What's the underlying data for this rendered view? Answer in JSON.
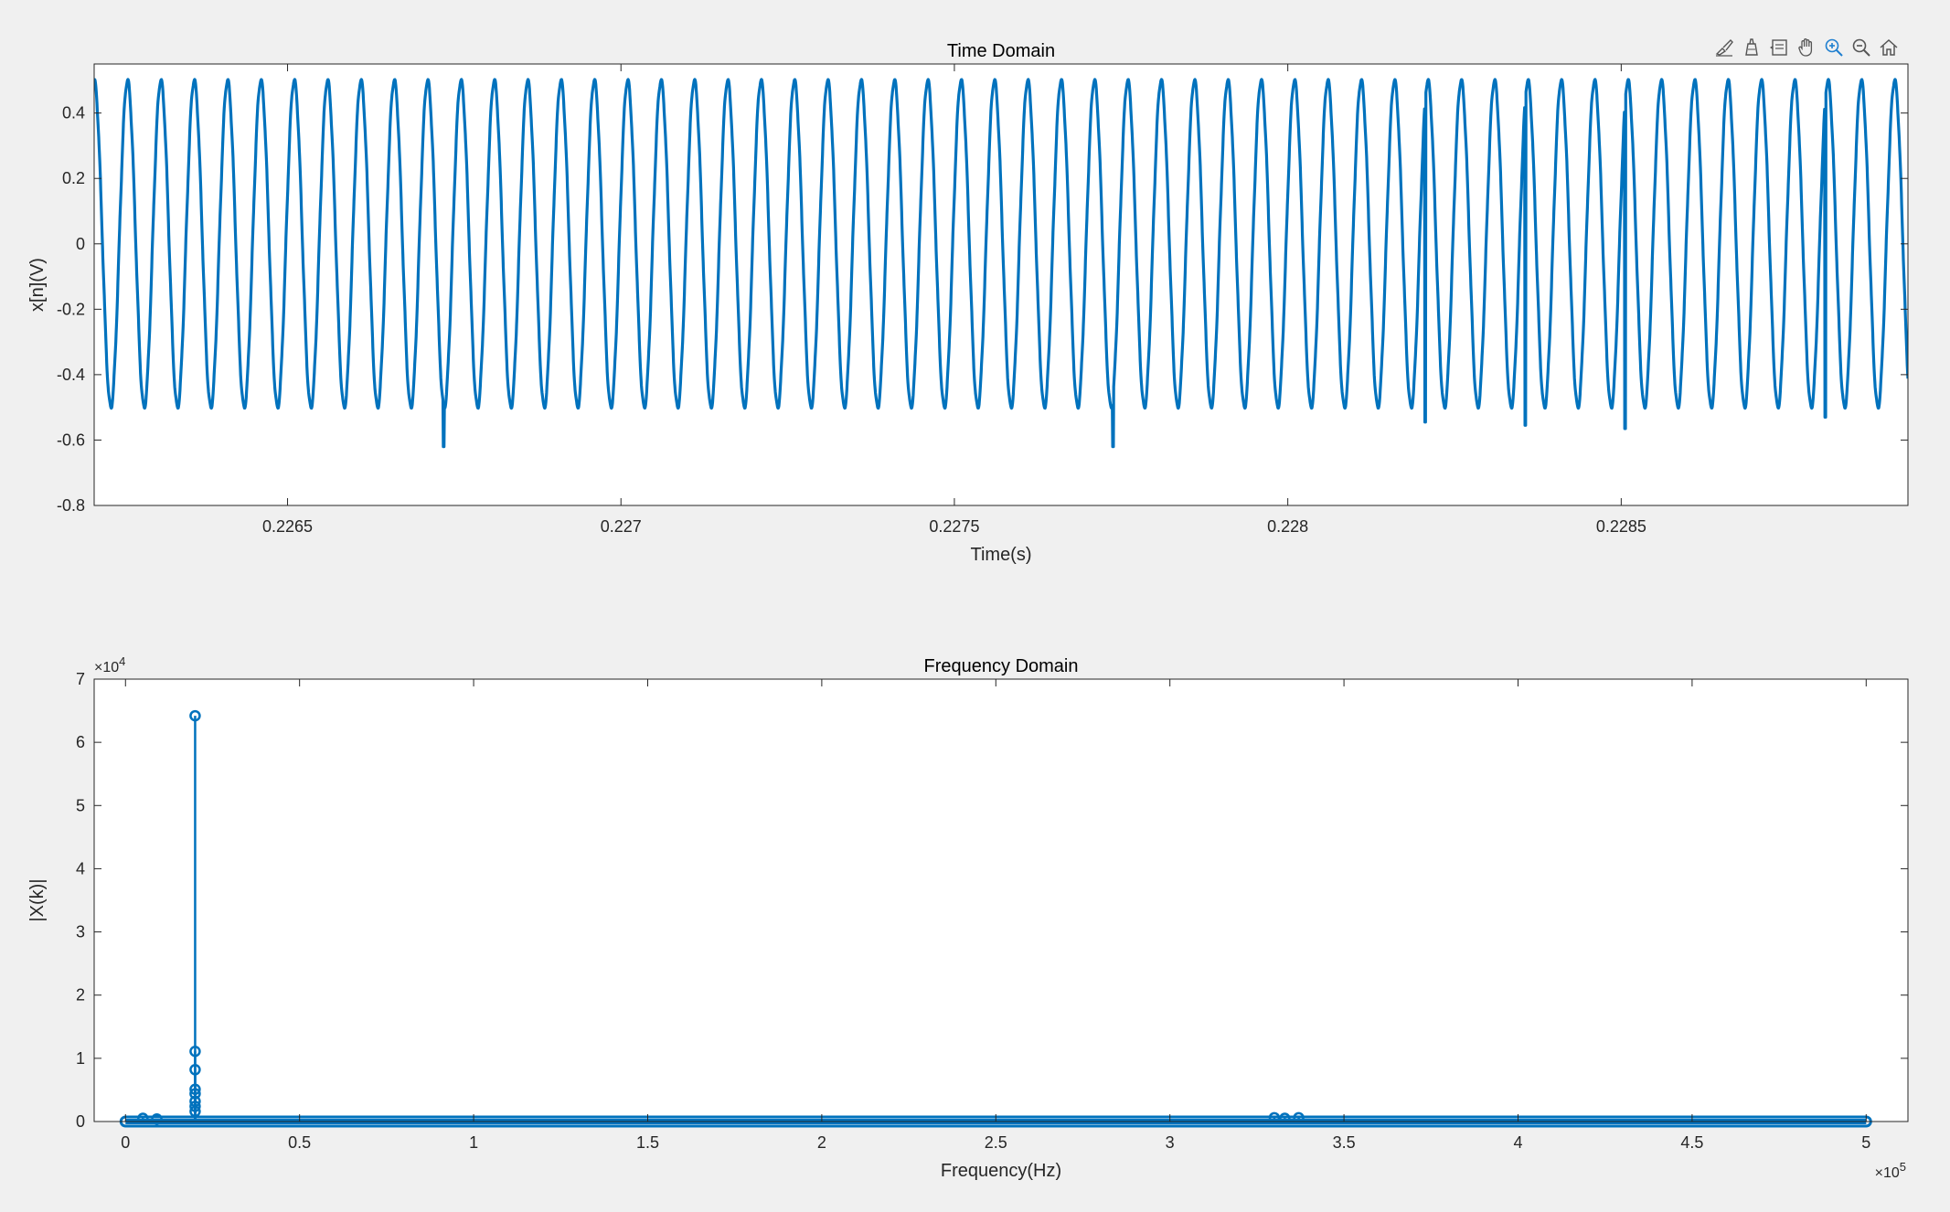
{
  "toolbar": {
    "icons": [
      "brush-icon",
      "data-cursor-icon",
      "datatip-icon",
      "pan-icon",
      "zoom-in-icon",
      "zoom-out-icon",
      "home-icon"
    ]
  },
  "colors": {
    "line": "#0072BD",
    "background": "#f0f0f0",
    "axes": "#ffffff",
    "axis_line": "#262626"
  },
  "chart_data": [
    {
      "type": "line",
      "title": "Time Domain",
      "xlabel": "Time(s)",
      "ylabel": "x[n](V)",
      "xlim": [
        0.22621,
        0.22893
      ],
      "ylim": [
        -0.8,
        0.55
      ],
      "xticks": [
        0.2265,
        0.227,
        0.2275,
        0.228,
        0.2285
      ],
      "xtick_labels": [
        "0.2265",
        "0.227",
        "0.2275",
        "0.228",
        "0.2285"
      ],
      "yticks": [
        -0.8,
        -0.6,
        -0.4,
        -0.2,
        0,
        0.2,
        0.4
      ],
      "ytick_labels": [
        "-0.8",
        "-0.6",
        "-0.4",
        "-0.2",
        "0",
        "0.2",
        "0.4"
      ],
      "signal": {
        "frequency_hz": 20000,
        "amplitude_v": 0.5,
        "t_start": 0.22621,
        "t_end": 0.22893,
        "start_value": 0.5,
        "end_value": -0.5,
        "spikes": [
          {
            "t": 0.226734,
            "v": -0.62
          },
          {
            "t": 0.227738,
            "v": -0.62
          },
          {
            "t": 0.228206,
            "v": -0.545
          },
          {
            "t": 0.228356,
            "v": -0.555
          },
          {
            "t": 0.228506,
            "v": -0.565
          },
          {
            "t": 0.228806,
            "v": -0.53
          }
        ]
      },
      "grid": false
    },
    {
      "type": "stem",
      "title": "Frequency Domain",
      "xlabel": "Frequency(Hz)",
      "ylabel": "|X(k)|",
      "x_multiplier_label": "×10",
      "x_multiplier_exp": "5",
      "y_multiplier_label": "×10",
      "y_multiplier_exp": "4",
      "xlim": [
        -9000,
        512000
      ],
      "ylim": [
        0,
        70000
      ],
      "xticks": [
        0,
        50000,
        100000,
        150000,
        200000,
        250000,
        300000,
        350000,
        400000,
        450000,
        500000
      ],
      "xtick_labels": [
        "0",
        "0.5",
        "1",
        "1.5",
        "2",
        "2.5",
        "3",
        "3.5",
        "4",
        "4.5",
        "5"
      ],
      "yticks": [
        0,
        10000,
        20000,
        30000,
        40000,
        50000,
        60000,
        70000
      ],
      "ytick_labels": [
        "0",
        "1",
        "2",
        "3",
        "4",
        "5",
        "6",
        "7"
      ],
      "x_range": [
        0,
        500000
      ],
      "baseline_value": 0,
      "peaks": [
        {
          "x": 20000,
          "y": 64200
        },
        {
          "x": 20000,
          "y": 11100
        },
        {
          "x": 20000,
          "y": 8200
        },
        {
          "x": 20000,
          "y": 5100
        },
        {
          "x": 20000,
          "y": 4400
        },
        {
          "x": 20000,
          "y": 3200
        },
        {
          "x": 20000,
          "y": 2400
        },
        {
          "x": 20000,
          "y": 1600
        },
        {
          "x": 5000,
          "y": 500
        },
        {
          "x": 9000,
          "y": 400
        },
        {
          "x": 330000,
          "y": 600
        },
        {
          "x": 333000,
          "y": 500
        },
        {
          "x": 337000,
          "y": 600
        }
      ],
      "grid": false
    }
  ]
}
